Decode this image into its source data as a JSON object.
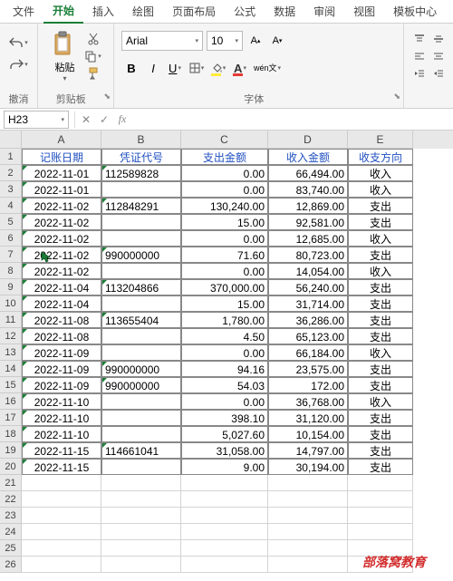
{
  "menu": {
    "items": [
      "文件",
      "开始",
      "插入",
      "绘图",
      "页面布局",
      "公式",
      "数据",
      "审阅",
      "视图",
      "模板中心"
    ],
    "active": 1
  },
  "ribbon": {
    "undo_label": "撤消",
    "paste_label": "粘贴",
    "clipboard_label": "剪贴板",
    "font_name": "Arial",
    "font_size": "10",
    "font_label": "字体"
  },
  "namebox": "H23",
  "columns": [
    "A",
    "B",
    "C",
    "D",
    "E"
  ],
  "headers": [
    "记账日期",
    "凭证代号",
    "支出金额",
    "收入金额",
    "收支方向"
  ],
  "rows": [
    {
      "r": 2,
      "d": "2022-11-01",
      "v": "112589828",
      "out": "0.00",
      "in": "66,494.00",
      "dir": "收入",
      "tri": [
        0,
        1
      ]
    },
    {
      "r": 3,
      "d": "2022-11-01",
      "v": "",
      "out": "0.00",
      "in": "83,740.00",
      "dir": "收入",
      "tri": [
        0
      ]
    },
    {
      "r": 4,
      "d": "2022-11-02",
      "v": "112848291",
      "out": "130,240.00",
      "in": "12,869.00",
      "dir": "支出",
      "tri": [
        0,
        1
      ]
    },
    {
      "r": 5,
      "d": "2022-11-02",
      "v": "",
      "out": "15.00",
      "in": "92,581.00",
      "dir": "支出",
      "tri": [
        0
      ]
    },
    {
      "r": 6,
      "d": "2022-11-02",
      "v": "",
      "out": "0.00",
      "in": "12,685.00",
      "dir": "收入",
      "tri": [
        0
      ]
    },
    {
      "r": 7,
      "d": "2022-11-02",
      "v": "990000000",
      "out": "71.60",
      "in": "80,723.00",
      "dir": "支出",
      "tri": [
        0,
        1
      ],
      "cursor": true
    },
    {
      "r": 8,
      "d": "2022-11-02",
      "v": "",
      "out": "0.00",
      "in": "14,054.00",
      "dir": "收入",
      "tri": [
        0
      ]
    },
    {
      "r": 9,
      "d": "2022-11-04",
      "v": "113204866",
      "out": "370,000.00",
      "in": "56,240.00",
      "dir": "支出",
      "tri": [
        0,
        1
      ]
    },
    {
      "r": 10,
      "d": "2022-11-04",
      "v": "",
      "out": "15.00",
      "in": "31,714.00",
      "dir": "支出",
      "tri": [
        0
      ]
    },
    {
      "r": 11,
      "d": "2022-11-08",
      "v": "113655404",
      "out": "1,780.00",
      "in": "36,286.00",
      "dir": "支出",
      "tri": [
        0,
        1
      ]
    },
    {
      "r": 12,
      "d": "2022-11-08",
      "v": "",
      "out": "4.50",
      "in": "65,123.00",
      "dir": "支出",
      "tri": [
        0
      ]
    },
    {
      "r": 13,
      "d": "2022-11-09",
      "v": "",
      "out": "0.00",
      "in": "66,184.00",
      "dir": "收入",
      "tri": [
        0
      ]
    },
    {
      "r": 14,
      "d": "2022-11-09",
      "v": "990000000",
      "out": "94.16",
      "in": "23,575.00",
      "dir": "支出",
      "tri": [
        0,
        1
      ]
    },
    {
      "r": 15,
      "d": "2022-11-09",
      "v": "990000000",
      "out": "54.03",
      "in": "172.00",
      "dir": "支出",
      "tri": [
        0,
        1
      ]
    },
    {
      "r": 16,
      "d": "2022-11-10",
      "v": "",
      "out": "0.00",
      "in": "36,768.00",
      "dir": "收入",
      "tri": [
        0
      ]
    },
    {
      "r": 17,
      "d": "2022-11-10",
      "v": "",
      "out": "398.10",
      "in": "31,120.00",
      "dir": "支出",
      "tri": [
        0
      ]
    },
    {
      "r": 18,
      "d": "2022-11-10",
      "v": "",
      "out": "5,027.60",
      "in": "10,154.00",
      "dir": "支出",
      "tri": [
        0
      ]
    },
    {
      "r": 19,
      "d": "2022-11-15",
      "v": "114661041",
      "out": "31,058.00",
      "in": "14,797.00",
      "dir": "支出",
      "tri": [
        0,
        1
      ]
    },
    {
      "r": 20,
      "d": "2022-11-15",
      "v": "",
      "out": "9.00",
      "in": "30,194.00",
      "dir": "支出",
      "tri": [
        0
      ]
    }
  ],
  "empty_rows": [
    21,
    22,
    23,
    24,
    25,
    26
  ],
  "watermark": "部落窝教育"
}
